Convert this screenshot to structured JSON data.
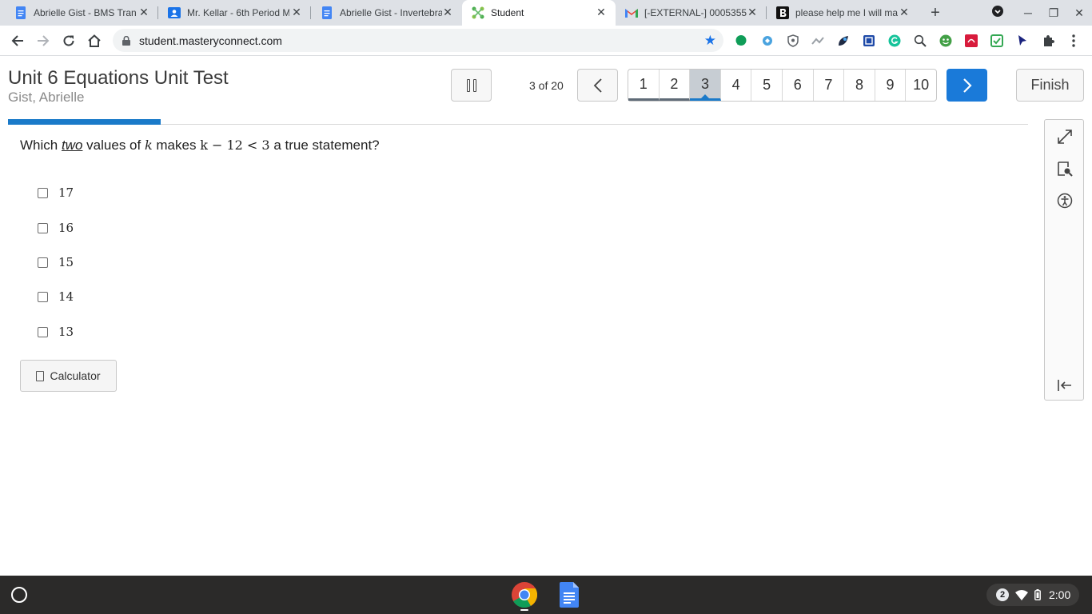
{
  "browser": {
    "tabs": [
      {
        "title": "Abrielle Gist - BMS Tran",
        "icon": "docs-icon",
        "active": false
      },
      {
        "title": "Mr. Kellar - 6th Period M",
        "icon": "classroom-icon",
        "active": false
      },
      {
        "title": "Abrielle Gist - Invertebra",
        "icon": "docs-icon",
        "active": false
      },
      {
        "title": "Student",
        "icon": "masteryconnect-icon",
        "active": true
      },
      {
        "title": "[-EXTERNAL-] 0005355",
        "icon": "gmail-icon",
        "active": false
      },
      {
        "title": "please help me I will ma",
        "icon": "brainly-icon",
        "active": false
      }
    ],
    "url": "student.masteryconnect.com"
  },
  "header": {
    "test_title": "Unit 6 Equations Unit Test",
    "student_name": "Gist, Abrielle",
    "progress_text": "3 of 20",
    "question_numbers": [
      "1",
      "2",
      "3",
      "4",
      "5",
      "6",
      "7",
      "8",
      "9",
      "10"
    ],
    "current_question": "3",
    "finish_label": "Finish",
    "progress_fraction": 0.15
  },
  "question": {
    "prefix": "Which",
    "emphasis": "two",
    "mid": "values of",
    "variable": "k",
    "makes": "makes",
    "expression": "k − 12 < 3",
    "suffix": "a true statement?",
    "choices": [
      "17",
      "16",
      "15",
      "14",
      "13"
    ]
  },
  "tools": {
    "calculator_label": "Calculator"
  },
  "taskbar": {
    "notification_count": "2",
    "time": "2:00"
  },
  "colors": {
    "accent": "#1a7ac9",
    "next_button": "#1a7ad9",
    "taskbar": "#2b2a29"
  }
}
